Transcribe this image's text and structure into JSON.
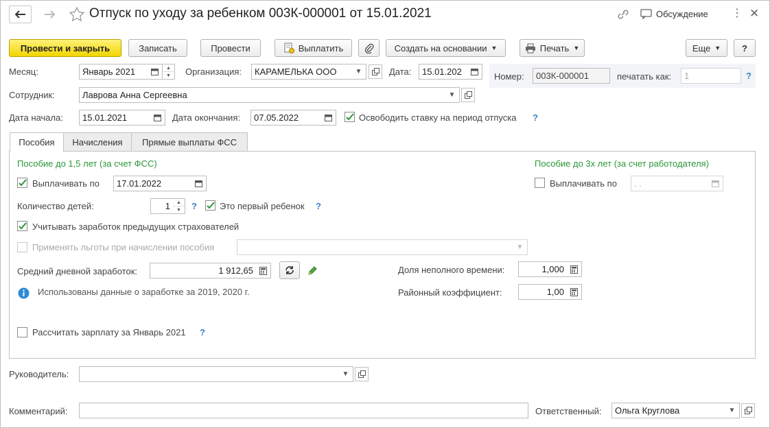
{
  "window": {
    "title": "Отпуск по уходу за ребенком 003К-000001 от 15.01.2021",
    "discussion_label": "Обсуждение"
  },
  "toolbar": {
    "post_close": "Провести и закрыть",
    "save": "Записать",
    "post": "Провести",
    "pay": "Выплатить",
    "create_based": "Создать на основании",
    "print": "Печать",
    "more": "Еще",
    "help": "?"
  },
  "header": {
    "month_label": "Месяц:",
    "month_value": "Январь 2021",
    "org_label": "Организация:",
    "org_value": "КАРАМЕЛЬКА ООО",
    "date_label": "Дата:",
    "date_value": "15.01.202",
    "number_label": "Номер:",
    "number_value": "003К-000001",
    "print_as_label": "печатать как:",
    "print_as_value": "1",
    "employee_label": "Сотрудник:",
    "employee_value": "Лаврова Анна Сергеевна",
    "start_label": "Дата начала:",
    "start_value": "15.01.2021",
    "end_label": "Дата окончания:",
    "end_value": "07.05.2022",
    "release_rate_label": "Освободить ставку на период отпуска",
    "release_rate_checked": true
  },
  "tabs": [
    {
      "label": "Пособия",
      "active": true
    },
    {
      "label": "Начисления",
      "active": false
    },
    {
      "label": "Прямые выплаты ФСС",
      "active": false
    }
  ],
  "benefits": {
    "fss_heading": "Пособие до 1,5 лет (за счет ФСС)",
    "employer_heading": "Пособие до 3х лет (за счет работодателя)",
    "pay_until_label": "Выплачивать по",
    "pay_until_value": "17.01.2022",
    "pay_until_checked": true,
    "emp_pay_until_label": "Выплачивать по",
    "emp_pay_until_value": ". .",
    "emp_pay_until_checked": false,
    "children_label": "Количество детей:",
    "children_value": "1",
    "first_child_label": "Это первый ребенок",
    "first_child_checked": true,
    "prev_insurers_label": "Учитывать заработок предыдущих страхователей",
    "prev_insurers_checked": true,
    "privileges_label": "Применять льготы при начислении пособия",
    "privileges_value": "",
    "avg_earnings_label": "Средний дневной заработок:",
    "avg_earnings_value": "1 912,65",
    "part_time_label": "Доля неполного времени:",
    "part_time_value": "1,000",
    "regional_label": "Районный коэффициент:",
    "regional_value": "1,00",
    "info_text": "Использованы данные о заработке за  2019,  2020 г.",
    "calc_salary_label": "Рассчитать зарплату за Январь 2021",
    "calc_salary_checked": false
  },
  "footer": {
    "manager_label": "Руководитель:",
    "manager_value": "",
    "comment_label": "Комментарий:",
    "comment_value": "",
    "responsible_label": "Ответственный:",
    "responsible_value": "Ольга Круглова"
  },
  "colors": {
    "primary_button": "#f2d500",
    "heading_green": "#2a9638",
    "help_blue": "#3a7fc4",
    "check_green": "#2a9638"
  }
}
